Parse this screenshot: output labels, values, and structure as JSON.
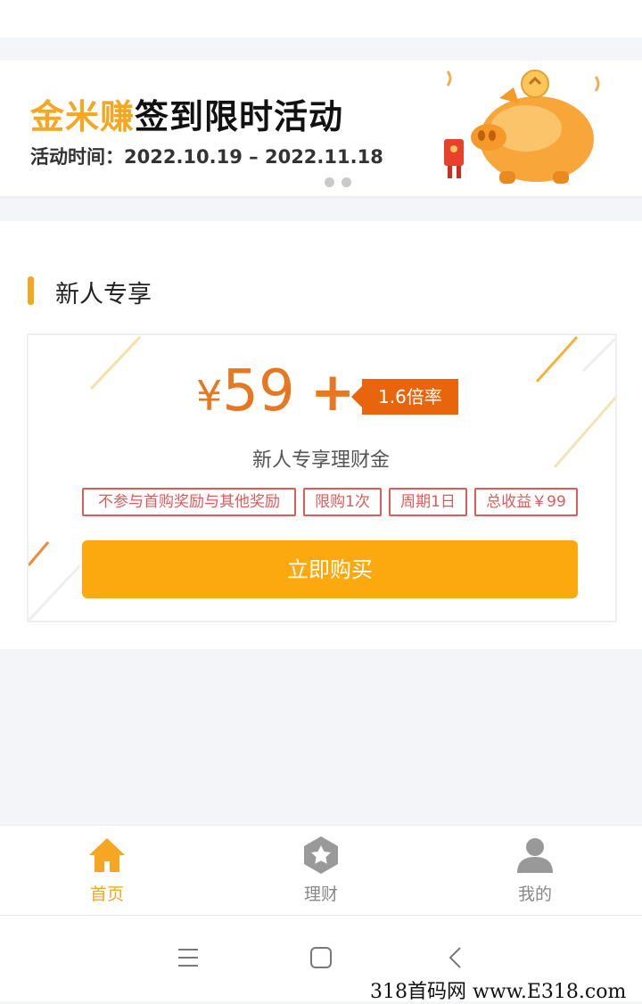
{
  "banner": {
    "brand": "金米赚",
    "title_rest": "签到限时活动",
    "date_label": "活动时间：",
    "date_range": "2022.10.19 – 2022.11.18",
    "accent": "#f5a623"
  },
  "section": {
    "title": "新人专享"
  },
  "offer": {
    "currency": "¥",
    "amount": "59",
    "plus": "+",
    "rate": "1.6倍率",
    "subtitle": "新人专享理财金",
    "tags": [
      "不参与首购奖励与其他奖励",
      "限购1次",
      "周期1日",
      "总收益￥99"
    ],
    "buy_label": "立即购买",
    "button_color": "#fca80f",
    "price_color": "#e87722"
  },
  "tabs": [
    {
      "label": "首页",
      "icon": "home-icon",
      "active": true
    },
    {
      "label": "理财",
      "icon": "star-hexagon-icon",
      "active": false
    },
    {
      "label": "我的",
      "icon": "user-icon",
      "active": false
    }
  ],
  "watermark": "318首码网 www.E318.com"
}
